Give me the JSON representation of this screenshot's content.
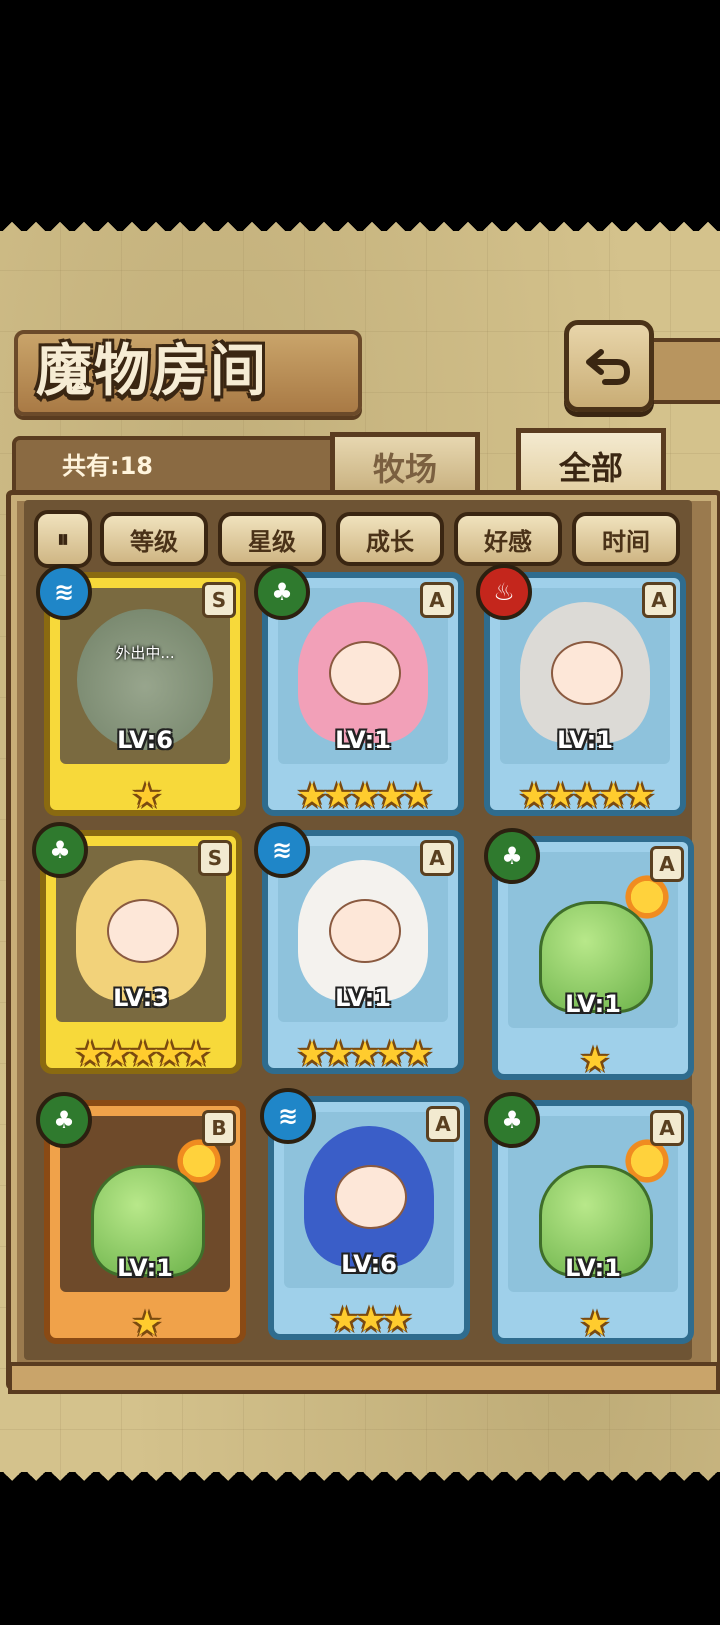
{
  "header": {
    "title": "魔物房间",
    "count_label": "共有:18"
  },
  "tabs": [
    {
      "label": "牧场",
      "active": false
    },
    {
      "label": "全部",
      "active": true
    }
  ],
  "filters": {
    "sort_icon": "sort-toggle-icon",
    "items": [
      "等级",
      "星级",
      "成长",
      "好感",
      "时间"
    ]
  },
  "cards": [
    {
      "frame": "gold",
      "element": "water",
      "rank": "S",
      "level": "LV:6",
      "stars": "★",
      "status": "外出中..."
    },
    {
      "frame": "blue",
      "element": "leaf",
      "rank": "A",
      "level": "LV:1",
      "stars": "★★★★★",
      "status": ""
    },
    {
      "frame": "blue",
      "element": "fire",
      "rank": "A",
      "level": "LV:1",
      "stars": "★★★★★",
      "status": ""
    },
    {
      "frame": "gold",
      "element": "leaf",
      "rank": "S",
      "level": "LV:3",
      "stars": "★★★★★",
      "status": ""
    },
    {
      "frame": "blue",
      "element": "water",
      "rank": "A",
      "level": "LV:1",
      "stars": "★★★★★",
      "status": ""
    },
    {
      "frame": "blue",
      "element": "leaf",
      "rank": "A",
      "level": "LV:1",
      "stars": "★",
      "status": ""
    },
    {
      "frame": "orange",
      "element": "leaf",
      "rank": "B",
      "level": "LV:1",
      "stars": "★",
      "status": ""
    },
    {
      "frame": "blue",
      "element": "water",
      "rank": "A",
      "level": "LV:6",
      "stars": "★★★",
      "status": ""
    },
    {
      "frame": "blue",
      "element": "leaf",
      "rank": "A",
      "level": "LV:1",
      "stars": "★",
      "status": ""
    }
  ],
  "colors": {
    "accent": "#5a3c20",
    "panel": "#9a7a4e",
    "star": "#ffcc2e"
  }
}
